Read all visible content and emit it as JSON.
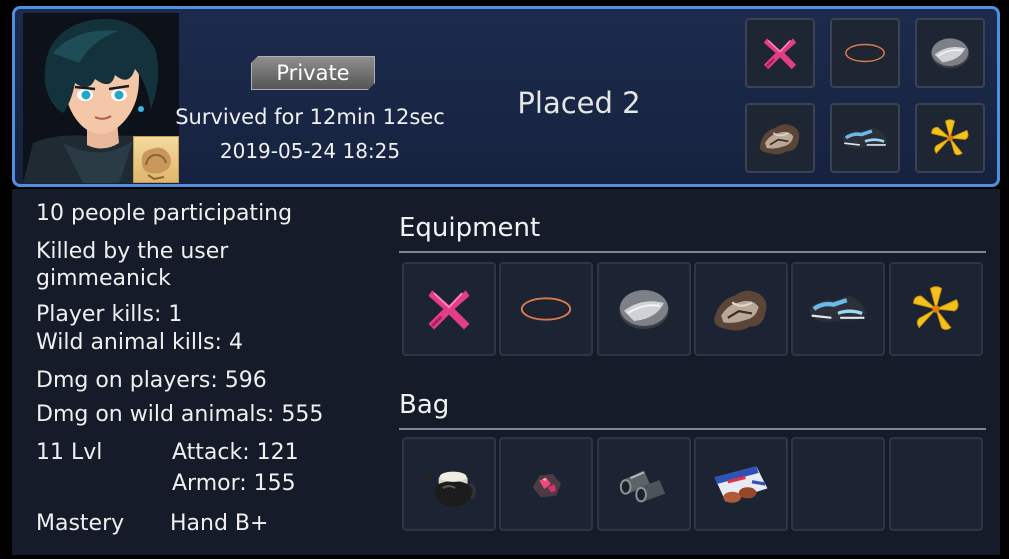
{
  "header": {
    "mode_badge": "Private",
    "survived": "Survived for 12min 12sec",
    "datetime": "2019-05-24 18:25",
    "placed": "Placed 2",
    "equipment_icons": [
      "pink-x-gloves-icon",
      "copper-ring-necklace-icon",
      "steel-disc-icon",
      "fur-armor-icon",
      "sneakers-icon",
      "yellow-flower-icon"
    ]
  },
  "stats": {
    "participants": "10 people participating",
    "killed_by_line1": "Killed by the user",
    "killed_by_line2": "gimmeanick",
    "player_kills": "Player kills: 1",
    "wild_animal_kills": "Wild animal kills: 4",
    "dmg_players": "Dmg on players: 596",
    "dmg_wild": "Dmg on wild animals: 555",
    "level": "11 Lvl",
    "attack": "Attack: 121",
    "armor": "Armor: 155",
    "mastery_label": "Mastery",
    "mastery_value": "Hand B+"
  },
  "equipment": {
    "title": "Equipment",
    "items": [
      "pink-x-gloves-icon",
      "copper-ring-necklace-icon",
      "steel-disc-icon",
      "fur-armor-icon",
      "sneakers-icon",
      "yellow-flower-icon"
    ]
  },
  "bag": {
    "title": "Bag",
    "items": [
      "teapot-icon",
      "ruby-ore-icon",
      "metal-pipes-icon",
      "chocolate-box-icon",
      "",
      ""
    ]
  },
  "colors": {
    "header_border": "#4f8fe0",
    "header_bg": "#1c2b4d",
    "panel_bg": "#151b29",
    "slot_bg": "#1c2433"
  }
}
